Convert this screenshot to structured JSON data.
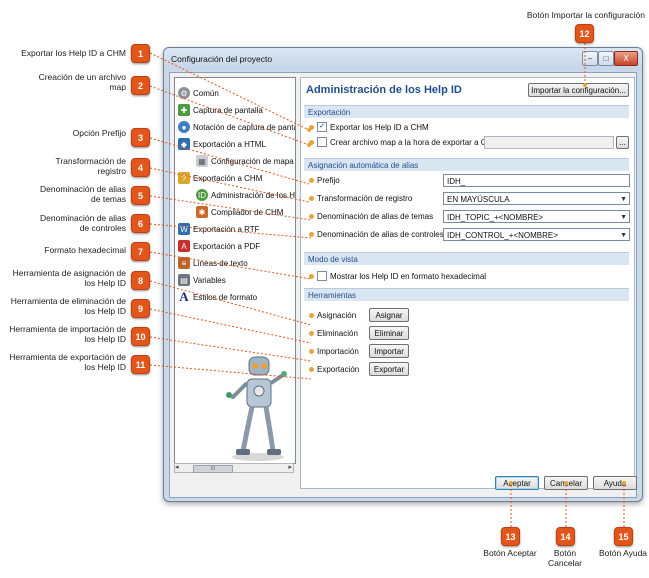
{
  "callouts": {
    "c1": {
      "num": "1",
      "text": "Exportar los Help ID a CHM"
    },
    "c2": {
      "num": "2",
      "text": "Creación de un archivo map"
    },
    "c3": {
      "num": "3",
      "text": "Opción Prefijo"
    },
    "c4": {
      "num": "4",
      "text": "Transformación de registro"
    },
    "c5": {
      "num": "5",
      "text": "Denominación de alias de temas"
    },
    "c6": {
      "num": "6",
      "text": "Denominación de alias de controles"
    },
    "c7": {
      "num": "7",
      "text": "Formato hexadecimal"
    },
    "c8": {
      "num": "8",
      "text": "Herramienta de asignación de los Help ID"
    },
    "c9": {
      "num": "9",
      "text": "Herramienta de eliminación de los Help ID"
    },
    "c10": {
      "num": "10",
      "text": "Herramienta de importación de los Help ID"
    },
    "c11": {
      "num": "11",
      "text": "Herramienta de exportación de los Help ID"
    },
    "c12": {
      "num": "12",
      "text": "Botón Importar la configuración"
    },
    "c13": {
      "num": "13",
      "text": "Botón Aceptar"
    },
    "c14": {
      "num": "14",
      "text": "Botón Cancelar"
    },
    "c15": {
      "num": "15",
      "text": "Botón Ayuda"
    }
  },
  "window": {
    "title": "Configuración del proyecto",
    "minimize": "–",
    "maximize": "□",
    "close": "X"
  },
  "tree": {
    "items": [
      {
        "label": "Común"
      },
      {
        "label": "Captura de pantalla"
      },
      {
        "label": "Notación de captura de pantal"
      },
      {
        "label": "Exportación a HTML"
      },
      {
        "label": "Configuración de mapa v"
      },
      {
        "label": "Exportación a CHM"
      },
      {
        "label": "Administración de los He"
      },
      {
        "label": "Compilador de CHM"
      },
      {
        "label": "Exportación a RTF"
      },
      {
        "label": "Exportación a PDF"
      },
      {
        "label": "Líneas de texto"
      },
      {
        "label": "Variables"
      },
      {
        "label": "Estilos de formato"
      }
    ],
    "scroll_thumb": "III"
  },
  "pane": {
    "title": "Administración de los Help ID",
    "import_button": "Importar la configuración...",
    "sections": {
      "export": "Exportación",
      "alias": "Asignación automática de alias",
      "view": "Modo de vista",
      "tools": "Herramientas"
    },
    "export_help_ids": {
      "label": "Exportar los Help ID a CHM",
      "checked": "✓"
    },
    "create_map": {
      "label": "Crear archivo map a la hora de exportar a CHM",
      "browse": "..."
    },
    "prefix": {
      "label": "Prefijo",
      "value": "IDH_"
    },
    "case_transform": {
      "label": "Transformación de registro",
      "value": "EN MAYÚSCULA"
    },
    "topic_alias": {
      "label": "Denominación de alias de temas",
      "value": "IDH_TOPIC_+<NOMBRE>"
    },
    "control_alias": {
      "label": "Denominación de alias de controles",
      "value": "IDH_CONTROL_+<NOMBRE>"
    },
    "hex": {
      "label": "Mostrar los Help ID en formato hexadecimal"
    },
    "tools": [
      {
        "label": "Asignación",
        "button": "Asignar"
      },
      {
        "label": "Eliminación",
        "button": "Eliminar"
      },
      {
        "label": "Importación",
        "button": "Importar"
      },
      {
        "label": "Exportación",
        "button": "Exportar"
      }
    ]
  },
  "footer": {
    "ok": "Aceptar",
    "cancel": "Cancelar",
    "help": "Ayuda"
  },
  "colors": {
    "badge": "#e2561b",
    "section": "#dbe6f3",
    "title": "#1f4e8c"
  }
}
